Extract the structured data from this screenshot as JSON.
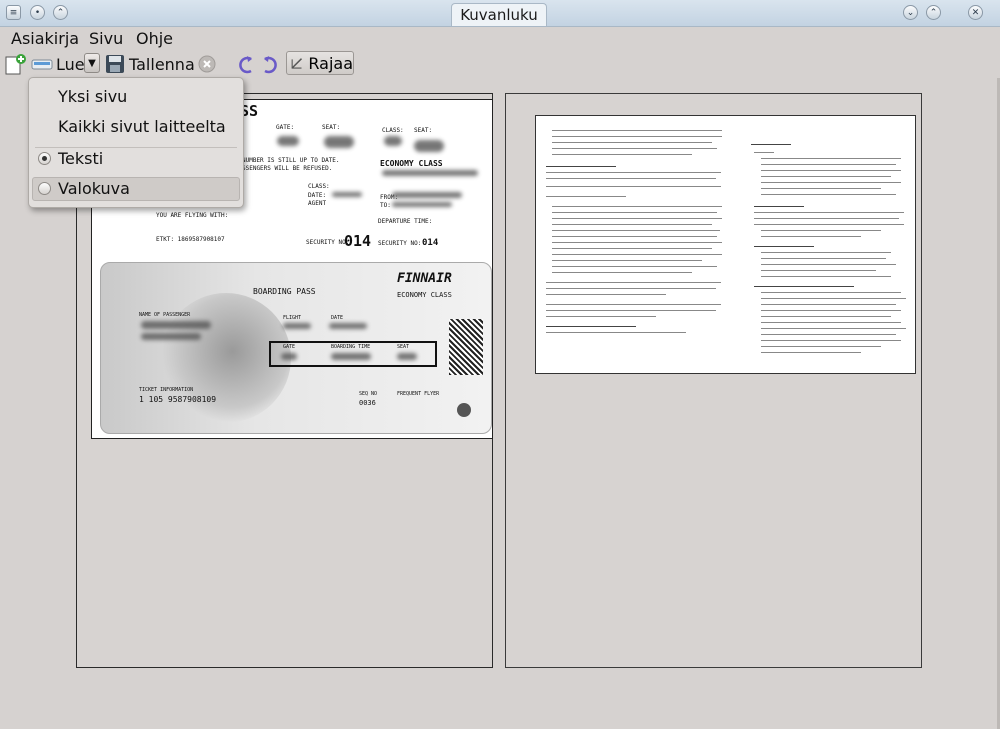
{
  "window": {
    "title": "Kuvanluku"
  },
  "menu": {
    "items": [
      {
        "label": "Asiakirja"
      },
      {
        "label": "Sivu"
      },
      {
        "label": "Ohje"
      }
    ]
  },
  "toolbar": {
    "scan_label": "Lue",
    "save_label": "Tallenna",
    "crop_label": "Rajaa"
  },
  "scan_menu": {
    "single_page": "Yksi sivu",
    "all_pages": "Kaikki sivut laitteelta",
    "text_option": "Teksti",
    "photo_option": "Valokuva",
    "selected": "Teksti"
  },
  "pages": {
    "left": {
      "header_fragment": "SS",
      "gate_label": "GATE:",
      "seat_label": "SEAT:",
      "class_label": "CLASS:",
      "seat_label2": "SEAT:",
      "warning_line1": "NUMBER IS STILL UP TO DATE.",
      "warning_line2": "SSENGERS WILL BE REFUSED.",
      "economy_class": "ECONOMY CLASS",
      "class_label2": "CLASS:",
      "date_label": "DATE:",
      "agent_label": "AGENT",
      "from_label": "FROM:",
      "to_label": "TO:",
      "flying_with": "YOU ARE FLYING WITH:",
      "departure_time": "DEPARTURE TIME:",
      "etkt": "ETKT: 1869587908107",
      "security_label": "SECURITY NO:",
      "security_no": "014",
      "security_label2": "SECURITY NO:",
      "security_no2": "014",
      "airline": "FINNAIR",
      "boarding_pass": "BOARDING PASS",
      "economy_class2": "ECONOMY CLASS",
      "name_of_passenger": "NAME OF PASSENGER",
      "flight": "FLIGHT",
      "date": "DATE",
      "gate": "GATE",
      "boarding_time": "BOARDING TIME",
      "seat": "SEAT",
      "ticket_information": "TICKET INFORMATION",
      "ticket_number": "1 105 9587908109",
      "seq_no_label": "SEQ NO",
      "seq_no": "0036",
      "frequent_flyer": "FREQUENT FLYER"
    }
  },
  "colors": {
    "background": "#d6d2d0",
    "titlebar": "#c3d3e2",
    "accent_blue": "#4a7fb8"
  }
}
